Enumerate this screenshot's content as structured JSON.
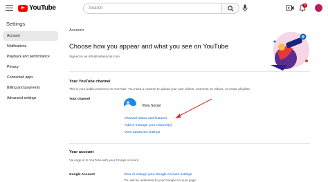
{
  "header": {
    "logo_text": "YouTube",
    "search_placeholder": "Search",
    "notification_count": "3"
  },
  "sidebar": {
    "title": "Settings",
    "items": [
      {
        "label": "Account",
        "active": true
      },
      {
        "label": "Notifications"
      },
      {
        "label": "Playback and performance"
      },
      {
        "label": "Privacy"
      },
      {
        "label": "Connected apps"
      },
      {
        "label": "Billing and payments"
      },
      {
        "label": "Advanced settings"
      }
    ]
  },
  "main": {
    "section_label": "Account",
    "headline": "Choose how you appear and what you see on YouTube",
    "signed_in": "Signed in as info@vistasocial.com",
    "channel": {
      "heading": "Your YouTube channel",
      "description": "This is your public presence on YouTube. You need a channel to upload your own videos, comment on videos, or create playlists.",
      "row_label": "Your channel",
      "channel_name": "Vista Social",
      "link_status": "Channel status and features",
      "link_manage": "Add or manage your channel(s)",
      "link_advanced": "View advanced settings"
    },
    "account": {
      "heading": "Your account",
      "description": "You sign in to YouTube with your Google Account",
      "row_label": "Google Account",
      "link_google": "View or change your Google Account settings",
      "redirect_note": "You will be redirected to your Google Account page"
    }
  },
  "colors": {
    "brand_red": "#ff0000",
    "link_blue": "#065fd4",
    "annotation_arrow": "#d32f2f"
  }
}
